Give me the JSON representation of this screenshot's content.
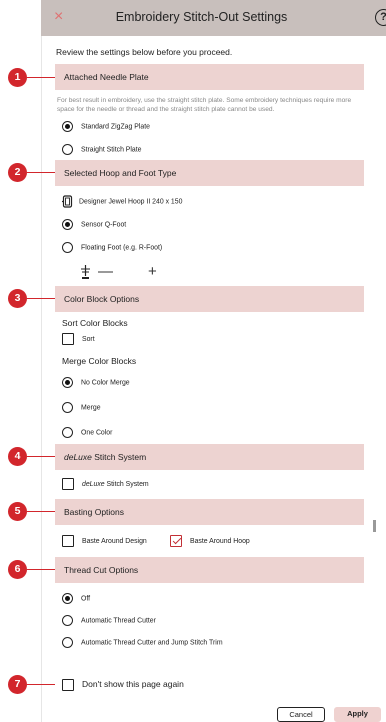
{
  "window": {
    "title": "Embroidery Stitch-Out Settings",
    "close_glyph": "×",
    "help_glyph": "?"
  },
  "intro": "Review the settings below before you proceed.",
  "sections": [
    {
      "number": "1",
      "title": "Attached Needle Plate"
    },
    {
      "number": "2",
      "title": "Selected Hoop and Foot Type"
    },
    {
      "number": "3",
      "title": "Color Block Options"
    },
    {
      "number": "4",
      "title_italic": "deLuxe",
      "title_rest": " Stitch System"
    },
    {
      "number": "5",
      "title": "Basting Options"
    },
    {
      "number": "6",
      "title": "Thread Cut Options"
    },
    {
      "number": "7"
    }
  ],
  "needle_plate": {
    "note": "For best result in embroidery, use the straight stitch plate. Some embroidery techniques require more space for the needle or thread and the straight stitch plate cannot be used.",
    "options": [
      "Standard ZigZag Plate",
      "Straight Stitch Plate"
    ],
    "selected": 0
  },
  "hoop_foot": {
    "hoop": "Designer Jewel Hoop II 240 x 150",
    "options": [
      "Sensor Q-Foot",
      "Floating Foot (e.g. R-Foot)"
    ],
    "selected": 0,
    "stepper_minus": "—",
    "stepper_plus": "+"
  },
  "color_block": {
    "sort_heading": "Sort Color Blocks",
    "sort_label": "Sort",
    "sort_checked": false,
    "merge_heading": "Merge Color Blocks",
    "merge_options": [
      "No Color Merge",
      "Merge",
      "One Color"
    ],
    "merge_selected": 0
  },
  "deluxe": {
    "label_italic": "deLuxe",
    "label_rest": " Stitch System",
    "checked": false
  },
  "basting": {
    "options": [
      {
        "label": "Baste Around Design",
        "checked": false
      },
      {
        "label": "Baste Around Hoop",
        "checked": true
      }
    ]
  },
  "thread_cut": {
    "options": [
      "Off",
      "Automatic Thread Cutter",
      "Automatic Thread Cutter and Jump Stitch Trim"
    ],
    "selected": 0
  },
  "dont_show": {
    "label": "Don't show this page again",
    "checked": false
  },
  "footer": {
    "cancel": "Cancel",
    "apply": "Apply"
  },
  "colors": {
    "badge": "#d2262c",
    "section_bg": "#edd3d1",
    "titlebar_bg": "#c8bfbc",
    "apply_bg": "#efd2d0"
  }
}
